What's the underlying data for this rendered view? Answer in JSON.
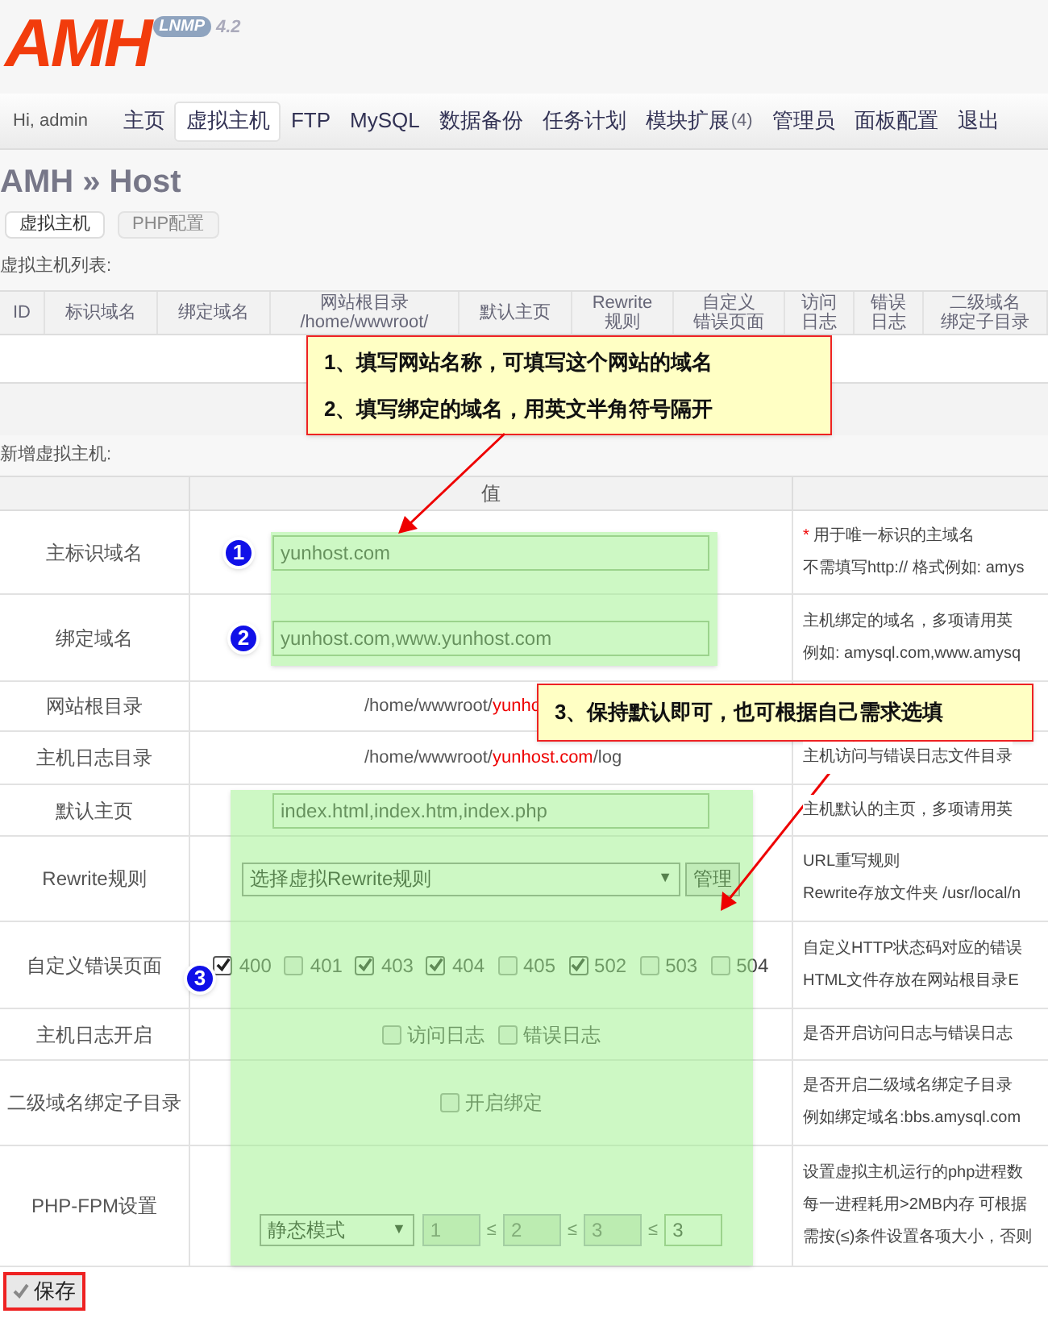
{
  "logo": {
    "name": "AMH",
    "badge": "LNMP",
    "version": "4.2"
  },
  "nav": {
    "greeting": "Hi, admin",
    "items": [
      {
        "label": "主页",
        "selected": false
      },
      {
        "label": "虚拟主机",
        "selected": true
      },
      {
        "label": "FTP",
        "selected": false
      },
      {
        "label": "MySQL",
        "selected": false
      },
      {
        "label": "数据备份",
        "selected": false
      },
      {
        "label": "任务计划",
        "selected": false
      },
      {
        "label": "模块扩展",
        "count": "(4)",
        "selected": false
      },
      {
        "label": "管理员",
        "selected": false
      },
      {
        "label": "面板配置",
        "selected": false
      },
      {
        "label": "退出",
        "selected": false
      }
    ]
  },
  "page_title": "AMH » Host",
  "sub_tabs": [
    {
      "label": "虚拟主机",
      "selected": true
    },
    {
      "label": "PHP配置",
      "selected": false
    }
  ],
  "host_list": {
    "title": "虚拟主机列表:",
    "columns": [
      [
        "ID"
      ],
      [
        "标识域名"
      ],
      [
        "绑定域名"
      ],
      [
        "网站根目录",
        "/home/wwwroot/"
      ],
      [
        "默认主页"
      ],
      [
        "Rewrite",
        "规则"
      ],
      [
        "自定义",
        "错误页面"
      ],
      [
        "访问",
        "日志"
      ],
      [
        "错误",
        "日志"
      ],
      [
        "二级域名",
        "绑定子目录"
      ]
    ]
  },
  "new_host": {
    "title": "新增虚拟主机:",
    "value_header": "值",
    "rows": [
      {
        "kind": "input",
        "label": "主标识域名",
        "value": "yunhost.com",
        "note_mark": "*",
        "desc": [
          "用于唯一标识的主域名",
          "不需填写http:// 格式例如: amys"
        ]
      },
      {
        "kind": "input",
        "label": "绑定域名",
        "value": "yunhost.com,www.yunhost.com",
        "desc": [
          "主机绑定的域名，多项请用英",
          "例如: amysql.com,www.amysq"
        ]
      },
      {
        "kind": "path",
        "label": "网站根目录",
        "prefix": "/home/wwwroot/",
        "highlight": "yunho",
        "desc": []
      },
      {
        "kind": "path",
        "label": "主机日志目录",
        "prefix": "/home/wwwroot/",
        "highlight": "yunhost.com",
        "suffix": "/log",
        "desc": [
          "主机访问与错误日志文件目录"
        ]
      },
      {
        "kind": "input",
        "label": "默认主页",
        "value": "index.html,index.htm,index.php",
        "desc": [
          "主机默认的主页，多项请用英"
        ]
      },
      {
        "kind": "select",
        "label": "Rewrite规则",
        "value": "选择虚拟Rewrite规则",
        "arrow": "▼",
        "button": "管理",
        "desc": [
          "URL重写规则",
          "Rewrite存放文件夹 /usr/local/n"
        ]
      },
      {
        "kind": "checkboxes",
        "label": "自定义错误页面",
        "options": [
          {
            "label": "400",
            "checked": true
          },
          {
            "label": "401",
            "checked": false
          },
          {
            "label": "403",
            "checked": true
          },
          {
            "label": "404",
            "checked": true
          },
          {
            "label": "405",
            "checked": false
          },
          {
            "label": "502",
            "checked": true
          },
          {
            "label": "503",
            "checked": false
          },
          {
            "label": "504",
            "checked": false
          }
        ],
        "desc": [
          "自定义HTTP状态码对应的错误",
          "HTML文件存放在网站根目录E"
        ]
      },
      {
        "kind": "checkboxes",
        "label": "主机日志开启",
        "options": [
          {
            "label": "访问日志",
            "checked": false
          },
          {
            "label": "错误日志",
            "checked": false
          }
        ],
        "desc": [
          "是否开启访问日志与错误日志"
        ]
      },
      {
        "kind": "checkboxes",
        "label": "二级域名绑定子目录",
        "options": [
          {
            "label": "开启绑定",
            "checked": false
          }
        ],
        "desc": [
          "是否开启二级域名绑定子目录",
          "例如绑定域名:bbs.amysql.com"
        ]
      },
      {
        "kind": "fpm",
        "label": "PHP-FPM设置",
        "value": "静态模式",
        "arrow": "▼",
        "fields": [
          {
            "value": "1",
            "disabled": true
          },
          {
            "prefix": "≤",
            "value": "2",
            "disabled": true
          },
          {
            "prefix": "≤",
            "value": "3",
            "disabled": true
          },
          {
            "prefix": "≤",
            "value": "3",
            "disabled": false
          }
        ],
        "desc": [
          "设置虚拟主机运行的php进程数",
          "每一进程耗用>2MB内存 可根据",
          "需按(≤)条件设置各项大小，否则"
        ]
      }
    ]
  },
  "save_button": "保存",
  "annotations": {
    "callouts": [
      [
        "1、填写网站名称，可填写这个网站的域名",
        "2、填写绑定的域名，用英文半角符号隔开"
      ],
      [
        "3、保持默认即可，也可根据自己需求选填"
      ]
    ],
    "badges": [
      "1",
      "2",
      "3"
    ]
  }
}
